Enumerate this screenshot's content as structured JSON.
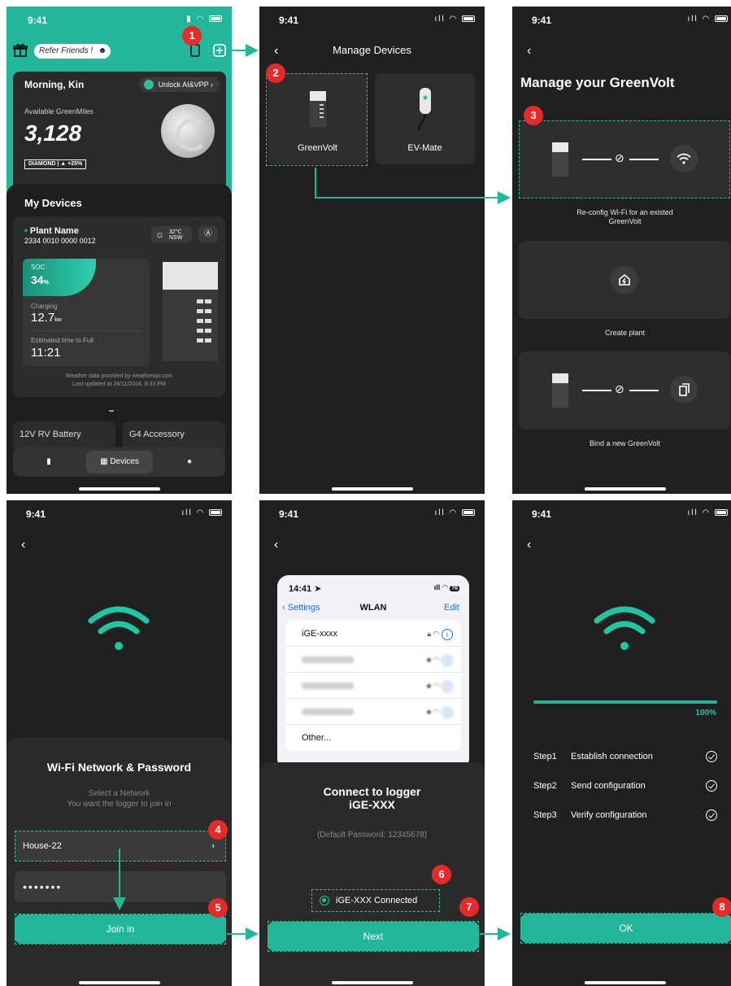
{
  "status": {
    "time": "9:41"
  },
  "badges": [
    "1",
    "2",
    "3",
    "4",
    "5",
    "6",
    "7",
    "8"
  ],
  "screen1": {
    "refer": "Refer Friends !",
    "greeting": "Morning, Kin",
    "unlock": "Unlock AI&VPP",
    "greenmiles_label": "Available GreenMiles",
    "greenmiles_value": "3,128",
    "tier": "DIAMOND | ▲ +25%",
    "my_devices": "My Devices",
    "plant_name": "Plant Name",
    "plant_sn": "2334 0010 0000 0012",
    "weather_temp": "32℃",
    "weather_region": "NSW",
    "soc_label": "SOC",
    "soc_value": "34",
    "soc_unit": "%",
    "soc_fraction": 0.34,
    "charging_label": "Charging",
    "charging_value": "12.7",
    "charging_unit": "kw",
    "eta_label": "Estimated time to Full",
    "eta_value": "11:21",
    "weather_note_1": "Weather data provided by weatherapi.com",
    "weather_note_2": "Last updated at 28/11/2024, 8:33 PM",
    "card_a": "12V RV Battery",
    "card_b": "G4 Accessory",
    "tab_devices": "Devices"
  },
  "screen2": {
    "title": "Manage Devices",
    "device_1": "GreenVolt",
    "device_2": "EV-Mate"
  },
  "screen3": {
    "title": "Manage your GreenVolt",
    "option_1_line1": "Re-config Wi-Fi for an existed",
    "option_1_line2": "GreenVolt",
    "option_2": "Create plant",
    "option_3": "Bind a new GreenVolt"
  },
  "screen4": {
    "sheet_title": "Wi-Fi Network & Password",
    "sub_line1": "Select a Network",
    "sub_line2": "You want the logger to join in",
    "network": "House-22",
    "password_mask": "•••••••",
    "join": "Join in"
  },
  "screen5": {
    "ios_time": "14:41",
    "ios_battery": "76",
    "ios_back": "Settings",
    "ios_title": "WLAN",
    "ios_edit": "Edit",
    "network_current": "iGE-xxxx",
    "other": "Other...",
    "title_line1": "Connect to logger",
    "title_line2": "iGE-XXX",
    "default_pw": "(Default Password: 12345678)",
    "connected": "iGE-XXX Connected",
    "next": "Next"
  },
  "screen6": {
    "progress_pct": "100%",
    "progress_fraction": 1.0,
    "steps": [
      {
        "num": "Step1",
        "text": "Establish connection"
      },
      {
        "num": "Step2",
        "text": "Send configuration"
      },
      {
        "num": "Step3",
        "text": "Verify configuration"
      }
    ],
    "ok": "OK"
  },
  "colors": {
    "accent": "#23b69a",
    "badge": "#e52a2a",
    "screen_bg": "#202020"
  }
}
